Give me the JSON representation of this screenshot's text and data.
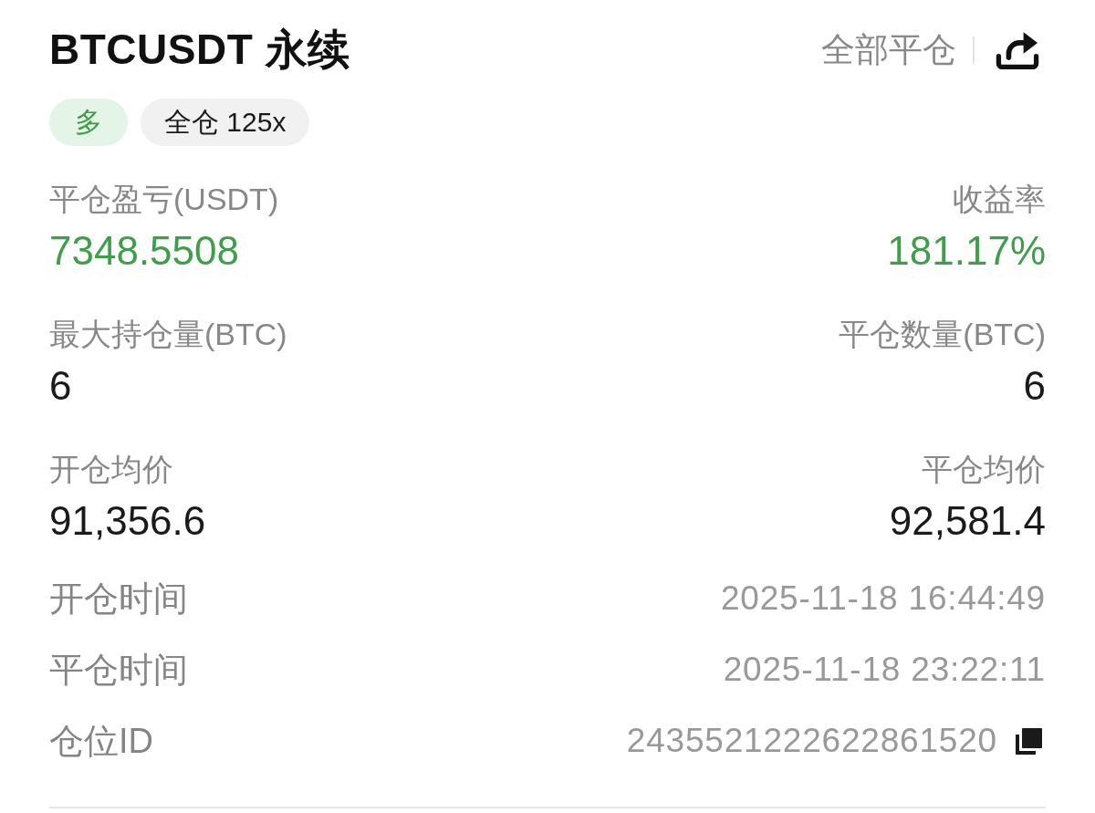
{
  "header": {
    "title": "BTCUSDT 永续",
    "close_all": "全部平仓"
  },
  "tags": [
    {
      "label": "多",
      "kind": "side"
    },
    {
      "label": "全仓 125x",
      "kind": "margin"
    }
  ],
  "stats": [
    {
      "left": {
        "label": "平仓盈亏(USDT)",
        "value": "7348.5508",
        "kind": "profit"
      },
      "right": {
        "label": "收益率",
        "value": "181.17%",
        "kind": "profit"
      }
    },
    {
      "left": {
        "label": "最大持仓量(BTC)",
        "value": "6",
        "kind": "plain"
      },
      "right": {
        "label": "平仓数量(BTC)",
        "value": "6",
        "kind": "plain"
      }
    },
    {
      "left": {
        "label": "开仓均价",
        "value": "91,356.6",
        "kind": "plain"
      },
      "right": {
        "label": "平仓均价",
        "value": "92,581.4",
        "kind": "plain"
      }
    }
  ],
  "details": [
    {
      "label": "开仓时间",
      "value": "2025-11-18 16:44:49",
      "copyable": false
    },
    {
      "label": "平仓时间",
      "value": "2025-11-18 23:22:11",
      "copyable": false
    },
    {
      "label": "仓位ID",
      "value": "2435521222622861520",
      "copyable": true
    }
  ]
}
